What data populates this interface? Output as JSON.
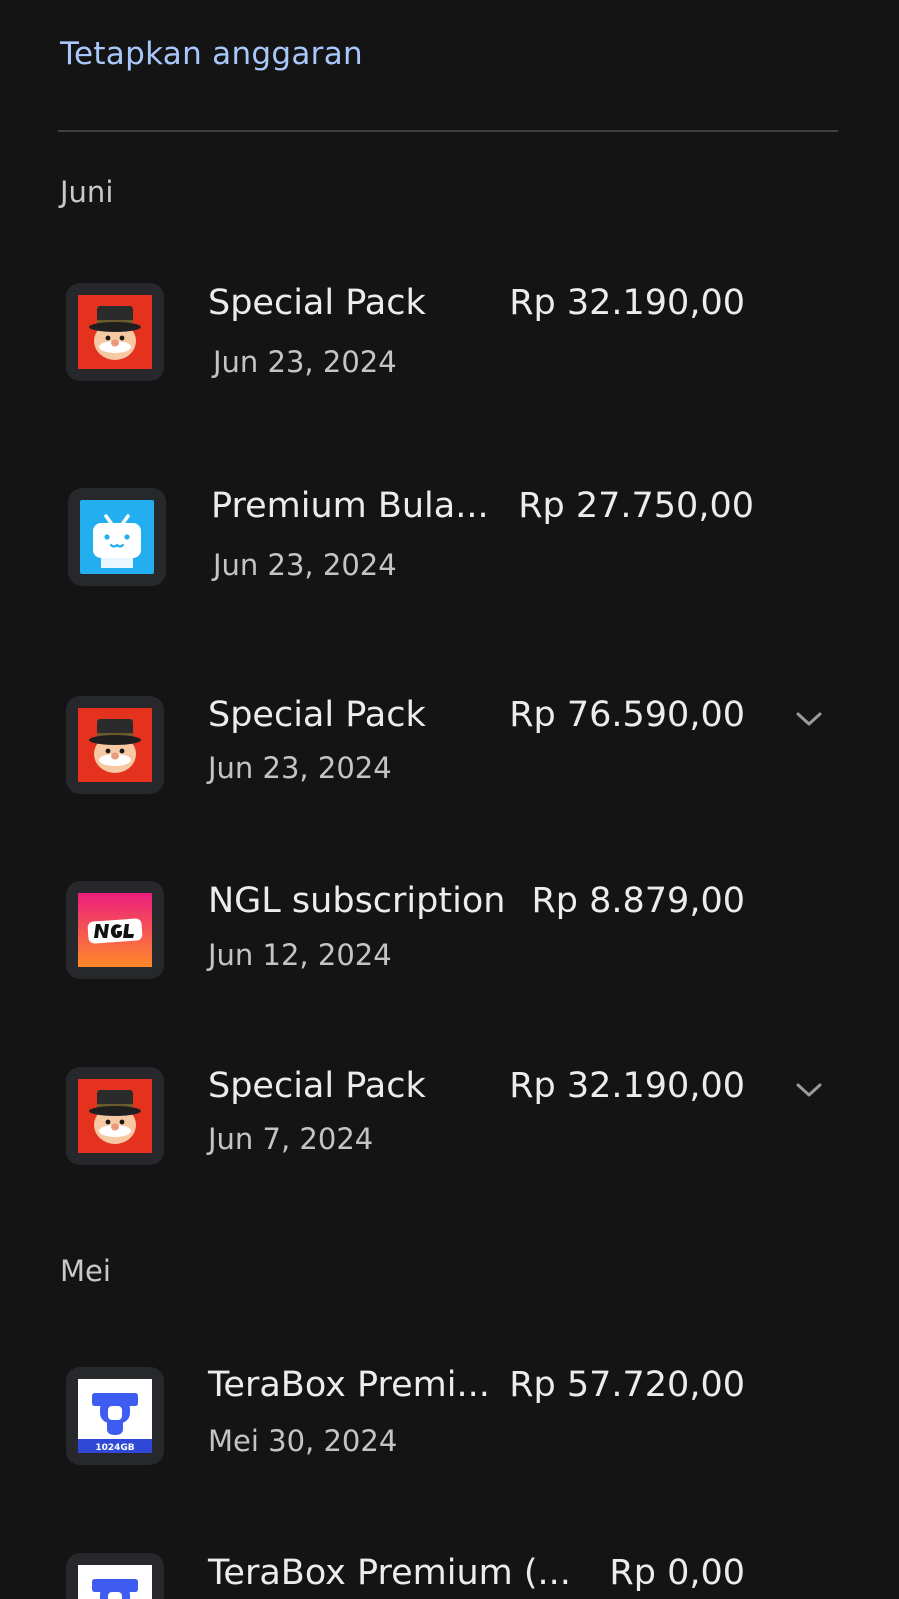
{
  "budget": {
    "link_label": "Tetapkan anggaran"
  },
  "sections": [
    {
      "label": "Juni",
      "items": [
        {
          "icon": "monopoly-app-icon",
          "title": "Special Pack",
          "date": "Jun 23, 2024",
          "price": "Rp 32.190,00",
          "expandable": false
        },
        {
          "icon": "bilibili-app-icon",
          "title": "Premium Bula...",
          "date": "Jun 23, 2024",
          "price": "Rp 27.750,00",
          "expandable": false
        },
        {
          "icon": "monopoly-app-icon",
          "title": "Special Pack",
          "date": "Jun 23, 2024",
          "price": "Rp 76.590,00",
          "expandable": true
        },
        {
          "icon": "ngl-app-icon",
          "title": "NGL subscription",
          "date": "Jun 12, 2024",
          "price": "Rp 8.879,00",
          "expandable": false
        },
        {
          "icon": "monopoly-app-icon",
          "title": "Special Pack",
          "date": "Jun 7, 2024",
          "price": "Rp 32.190,00",
          "expandable": true
        }
      ]
    },
    {
      "label": "Mei",
      "items": [
        {
          "icon": "terabox-app-icon",
          "icon_text": "1024GB",
          "title": "TeraBox Premi...",
          "date": "Mei 30, 2024",
          "price": "Rp 57.720,00",
          "expandable": false
        },
        {
          "icon": "terabox-app-icon",
          "title": "TeraBox Premium (...",
          "date": "",
          "price": "Rp 0,00",
          "expandable": false
        }
      ]
    }
  ],
  "colors": {
    "background": "#141414",
    "accent_link": "#a8c7fa",
    "divider": "#3f4043",
    "icon_tile": "#26282b"
  }
}
